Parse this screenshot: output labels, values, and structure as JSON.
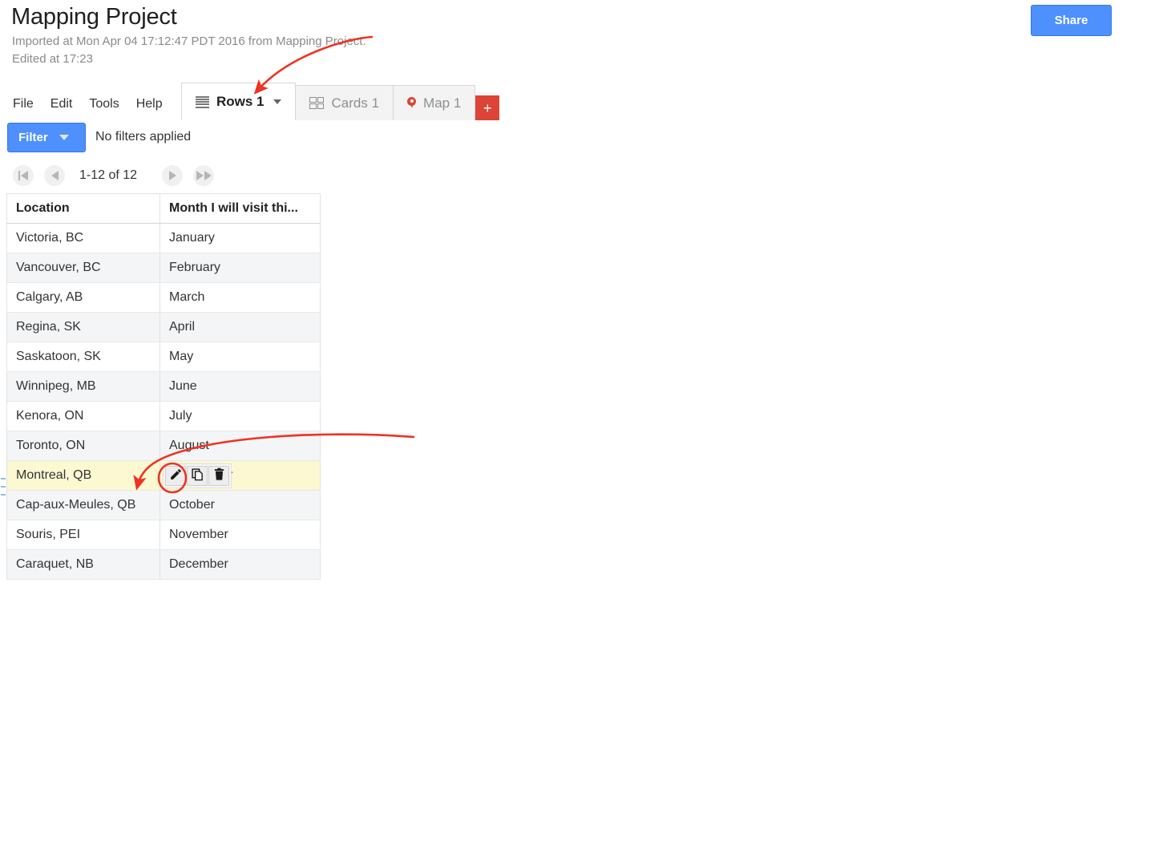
{
  "header": {
    "title": "Mapping Project",
    "imported_line": "Imported at Mon Apr 04 17:12:47 PDT 2016 from Mapping Project.",
    "edited_line": "Edited at 17:23",
    "share_label": "Share"
  },
  "menu": {
    "items": [
      {
        "label": "File"
      },
      {
        "label": "Edit"
      },
      {
        "label": "Tools"
      },
      {
        "label": "Help"
      }
    ]
  },
  "tabs": {
    "items": [
      {
        "label": "Rows 1",
        "icon": "rows-icon",
        "active": true,
        "has_caret": true
      },
      {
        "label": "Cards 1",
        "icon": "cards-icon",
        "active": false,
        "has_caret": false
      },
      {
        "label": "Map 1",
        "icon": "map-pin-icon",
        "active": false,
        "has_caret": false
      }
    ],
    "add_label": "+"
  },
  "filter_bar": {
    "filter_label": "Filter",
    "status_text": "No filters applied"
  },
  "pagination": {
    "first_icon": "first-page-icon",
    "prev_icon": "previous-page-icon",
    "range_text": "1-12 of 12",
    "next_icon": "next-page-icon",
    "last_icon": "last-page-icon"
  },
  "table": {
    "columns": [
      "Location",
      "Month I will visit thi..."
    ],
    "rows": [
      {
        "location": "Victoria, BC",
        "month": "January"
      },
      {
        "location": "Vancouver, BC",
        "month": "February"
      },
      {
        "location": "Calgary, AB",
        "month": "March"
      },
      {
        "location": "Regina, SK",
        "month": "April"
      },
      {
        "location": "Saskatoon, SK",
        "month": "May"
      },
      {
        "location": "Winnipeg, MB",
        "month": "June"
      },
      {
        "location": "Kenora, ON",
        "month": "July"
      },
      {
        "location": "Toronto, ON",
        "month": "August"
      },
      {
        "location": "Montreal, QB",
        "month": "r",
        "highlighted": true,
        "actions": true
      },
      {
        "location": "Cap-aux-Meules, QB",
        "month": "October"
      },
      {
        "location": "Souris, PEI",
        "month": "November"
      },
      {
        "location": "Caraquet, NB",
        "month": "December"
      }
    ],
    "row_actions": [
      {
        "name": "edit-row-button",
        "icon": "pencil-icon"
      },
      {
        "name": "duplicate-row-button",
        "icon": "copy-icon"
      },
      {
        "name": "delete-row-button",
        "icon": "trash-icon"
      }
    ]
  },
  "annotations": {
    "color": "#ee3322",
    "arrow_to_rows_tab": "arrow pointing at Rows 1 tab",
    "arrow_to_highlighted_row": "arrow pointing at Montreal QB row",
    "circle_on_edit": "ellipse highlighting the edit pencil button"
  },
  "colors": {
    "accent_blue": "#4d90fe",
    "tab_red": "#db4437",
    "highlight_yellow": "#fbf8d2",
    "annotation_red": "#ee3322"
  }
}
